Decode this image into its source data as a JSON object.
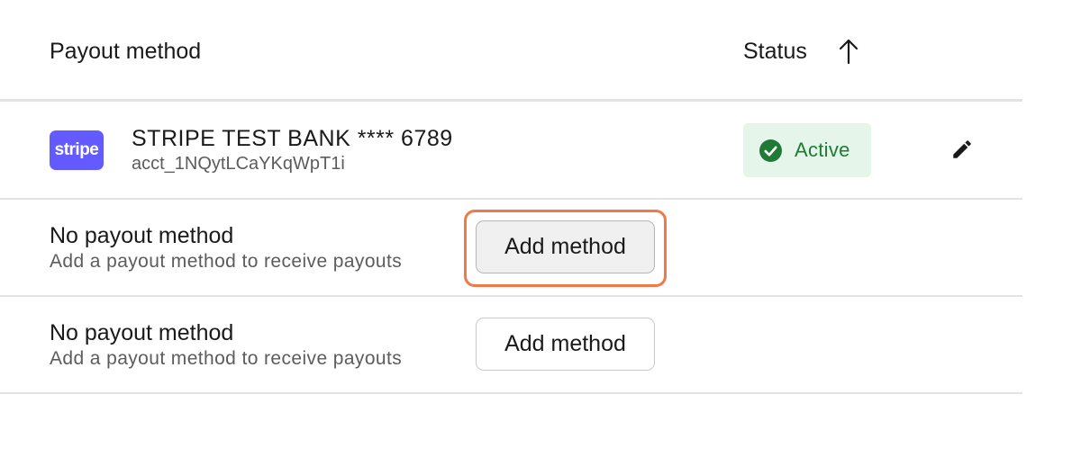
{
  "header": {
    "payout_label": "Payout method",
    "status_label": "Status",
    "sort_icon": "arrow-up-icon"
  },
  "rows": [
    {
      "logo_text": "stripe",
      "logo_color": "#635bff",
      "name": "STRIPE TEST BANK **** 6789",
      "account": "acct_1NQytLCaYKqWpT1i",
      "status": "Active",
      "status_color": "#1e7a34",
      "status_bg": "#e6f5ea",
      "edit_icon": "pencil-icon"
    },
    {
      "title": "No payout method",
      "subtitle": "Add a payout method to receive payouts",
      "button_label": "Add method",
      "focused": true,
      "focus_color": "#f07a47"
    },
    {
      "title": "No payout method",
      "subtitle": "Add a payout method to receive payouts",
      "button_label": "Add method",
      "focused": false
    }
  ]
}
